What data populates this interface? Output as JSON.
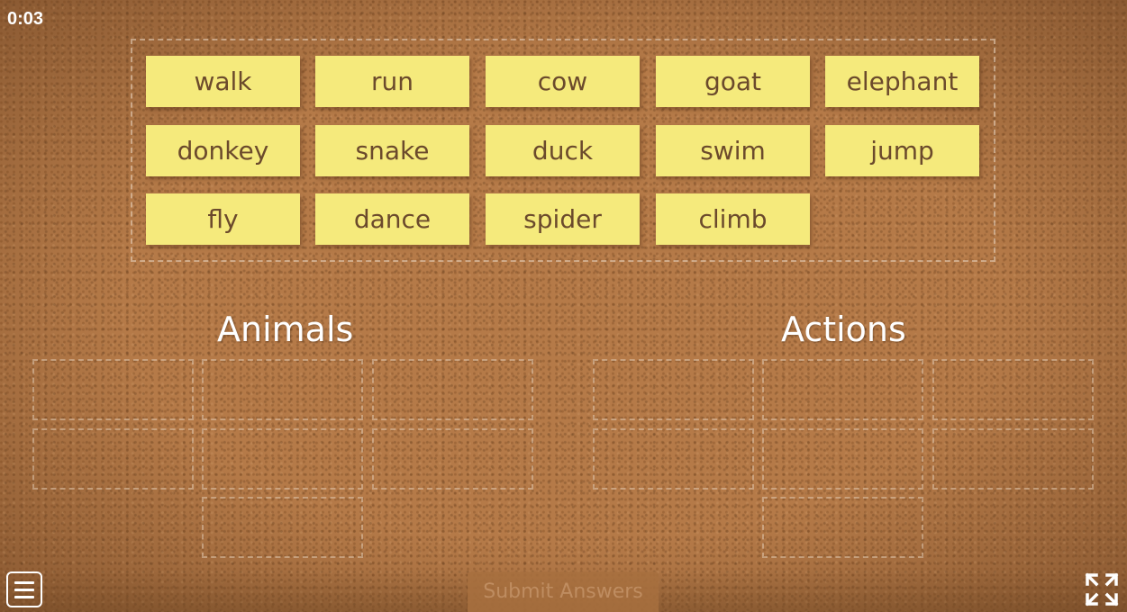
{
  "timer": "0:03",
  "word_bank": {
    "cards": [
      "walk",
      "run",
      "cow",
      "goat",
      "elephant",
      "donkey",
      "snake",
      "duck",
      "swim",
      "jump",
      "fly",
      "dance",
      "spider",
      "climb"
    ]
  },
  "categories": [
    {
      "title": "Animals"
    },
    {
      "title": "Actions"
    }
  ],
  "footer": {
    "submit_label": "Submit Answers",
    "menu_icon": "hamburger-menu-icon",
    "fullscreen_icon": "fullscreen-icon"
  },
  "colors": {
    "note": "#f5ea7c",
    "note_text": "#6b4a2c",
    "board": "#b57a48"
  }
}
